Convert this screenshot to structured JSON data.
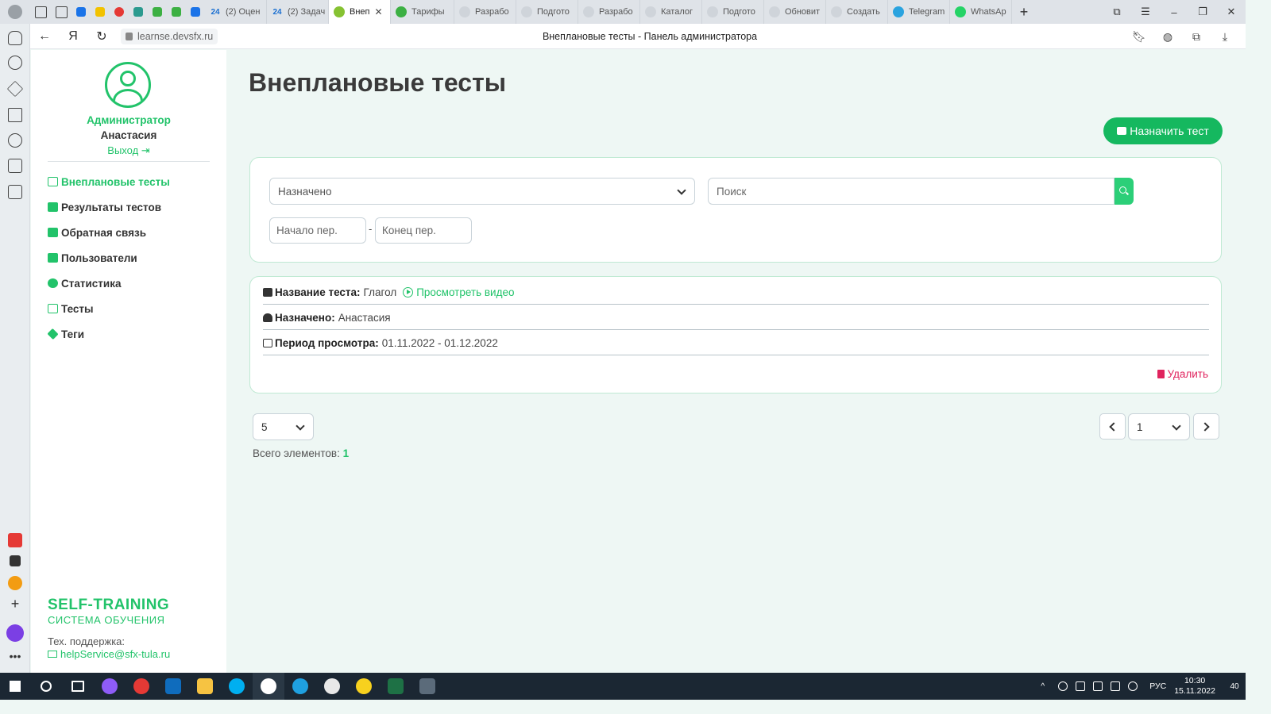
{
  "browser": {
    "url": "learnse.devsfx.ru",
    "window_title": "Внеплановые тесты - Панель администратора",
    "tabs": [
      {
        "label": "24",
        "title": "(2) Оцен",
        "color": "#1a6fd1"
      },
      {
        "label": "24",
        "title": "(2) Задач",
        "color": "#1a6fd1"
      },
      {
        "label": "",
        "title": "Внеп",
        "color": "#86c232",
        "active": true
      },
      {
        "label": "",
        "title": "Тарифы",
        "color": "#3cb043"
      },
      {
        "label": "",
        "title": "Разрабо",
        "color": "#cfd4da"
      },
      {
        "label": "",
        "title": "Подгото",
        "color": "#cfd4da"
      },
      {
        "label": "",
        "title": "Разрабо",
        "color": "#cfd4da"
      },
      {
        "label": "",
        "title": "Каталог",
        "color": "#cfd4da"
      },
      {
        "label": "",
        "title": "Подгото",
        "color": "#cfd4da"
      },
      {
        "label": "",
        "title": "Обновит",
        "color": "#cfd4da"
      },
      {
        "label": "",
        "title": "Создать",
        "color": "#cfd4da"
      },
      {
        "label": "",
        "title": "Telegram",
        "color": "#2aa3df"
      },
      {
        "label": "",
        "title": "WhatsAp",
        "color": "#25d366"
      }
    ]
  },
  "sidebar": {
    "role": "Администратор",
    "username": "Анастасия",
    "logout": "Выход",
    "menu": [
      {
        "label": "Внеплановые тесты",
        "icon": "calendar-check-icon",
        "active": true
      },
      {
        "label": "Результаты тестов",
        "icon": "graduation-cap-icon"
      },
      {
        "label": "Обратная связь",
        "icon": "chat-icon"
      },
      {
        "label": "Пользователи",
        "icon": "users-icon"
      },
      {
        "label": "Статистика",
        "icon": "pie-chart-icon"
      },
      {
        "label": "Тесты",
        "icon": "list-icon"
      },
      {
        "label": "Теги",
        "icon": "tag-icon"
      }
    ],
    "brand": "SELF-TRAINING",
    "brand_sub": "СИСТЕМА ОБУЧЕНИЯ",
    "support_label": "Тех. поддержка:",
    "support_email": "helpService@sfx-tula.ru"
  },
  "main": {
    "title": "Внеплановые тесты",
    "assign_button": "Назначить тест",
    "filter": {
      "assigned_select": "Назначено",
      "search_placeholder": "Поиск",
      "start_placeholder": "Начало пер.",
      "end_placeholder": "Конец пер.",
      "dash": "-"
    },
    "test": {
      "name_label": "Название теста:",
      "name_value": "Глагол",
      "video_link": "Просмотреть видео",
      "assigned_label": "Назначено:",
      "assigned_value": "Анастасия",
      "period_label": "Период просмотра:",
      "period_value": "01.11.2022 - 01.12.2022",
      "delete": "Удалить"
    },
    "pagination": {
      "per_page": "5",
      "total_label": "Всего элементов:",
      "total_value": "1",
      "page": "1"
    }
  },
  "taskbar": {
    "lang": "РУС",
    "time": "10:30",
    "date": "15.11.2022",
    "notifications": "40"
  }
}
